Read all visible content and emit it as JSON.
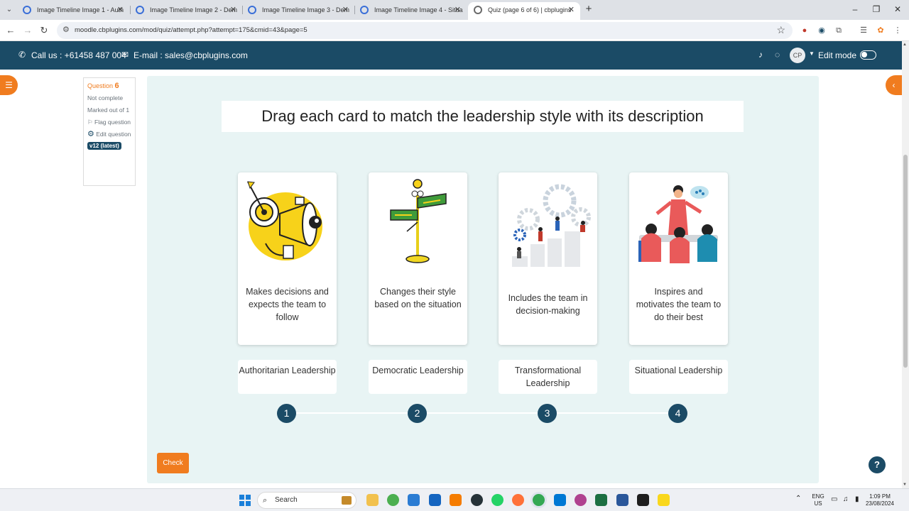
{
  "browser": {
    "tabs": [
      {
        "title": "Image Timeline Image 1 - Auth",
        "active": false
      },
      {
        "title": "Image Timeline Image 2 - Dem",
        "active": false
      },
      {
        "title": "Image Timeline Image 3 - Dem",
        "active": false
      },
      {
        "title": "Image Timeline Image 4 - Situa",
        "active": false
      },
      {
        "title": "Quiz (page 6 of 6) | cbplugins",
        "active": true
      }
    ],
    "url": "moodle.cbplugins.com/mod/quiz/attempt.php?attempt=175&cmid=43&page=5"
  },
  "header": {
    "phone": "Call us : +61458 487 004",
    "email": "E-mail : sales@cbplugins.com",
    "avatar_initials": "CP",
    "edit_mode_label": "Edit mode"
  },
  "question_info": {
    "question_label": "Question",
    "question_number": "6",
    "status": "Not complete",
    "marked_out_of": "Marked out of 1",
    "flag_label": "Flag question",
    "edit_label": "Edit question",
    "version_badge": "v12 (latest)"
  },
  "quiz": {
    "title": "Drag each card to match the leadership style with its description",
    "cards": [
      {
        "description": "Makes decisions and expects the team to follow",
        "image": "megaphone-illustration"
      },
      {
        "description": "Changes their style based on the situation",
        "image": "signpost-illustration"
      },
      {
        "description": "Includes the team in decision-making",
        "image": "gears-team-illustration"
      },
      {
        "description": "Inspires and motivates the team to do their best",
        "image": "speaker-audience-illustration"
      }
    ],
    "labels": [
      "Authoritarian Leadership",
      "Democratic Leadership",
      "Transformational Leadership",
      "Situational Leadership"
    ],
    "steps": [
      "1",
      "2",
      "3",
      "4"
    ],
    "check_label": "Check",
    "help_label": "?"
  },
  "taskbar": {
    "search_label": "Search",
    "language": "ENG",
    "region": "US",
    "time": "1:09 PM",
    "date": "23/08/2024"
  },
  "colors": {
    "header_bg": "#1b4b66",
    "accent_orange": "#f07c1f",
    "panel_bg": "#e8f4f4",
    "step_bg": "#1b4b66"
  }
}
